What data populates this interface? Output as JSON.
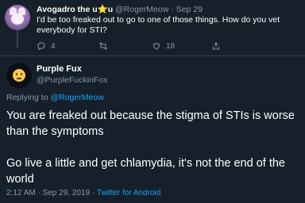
{
  "parent_tweet": {
    "display_name_prefix": "Avogadro the u",
    "display_name_star": "⭐",
    "display_name_suffix": "u",
    "handle": "@RogerMeow",
    "separator": "·",
    "date": "Sep 29",
    "body": "I'd be too freaked out to go to one of those things. How do you vet everybody for STI?",
    "reply_count": "4",
    "retweet_count": "",
    "like_count": "18"
  },
  "focused_tweet": {
    "display_name": "Purple Fux",
    "handle": "@PurpleFuckinFox",
    "replying_to_label": "Replying to",
    "replying_to_handle": "@RogerMeow",
    "paragraph_1": "You are freaked out because the stigma of STIs is worse than the symptoms",
    "paragraph_2": "Go live a little and get chlamydia, it's not the end of the world",
    "timestamp": "2:12 AM · Sep 29, 2019 ·",
    "source": "Twitter for Android"
  },
  "colors": {
    "background": "#15202b",
    "text": "#ffffff",
    "muted": "#8899a6",
    "link": "#1da1f2",
    "divider": "#38444d"
  },
  "icons": {
    "reply": "reply-icon",
    "retweet": "retweet-icon",
    "like": "heart-icon",
    "share": "share-icon"
  }
}
